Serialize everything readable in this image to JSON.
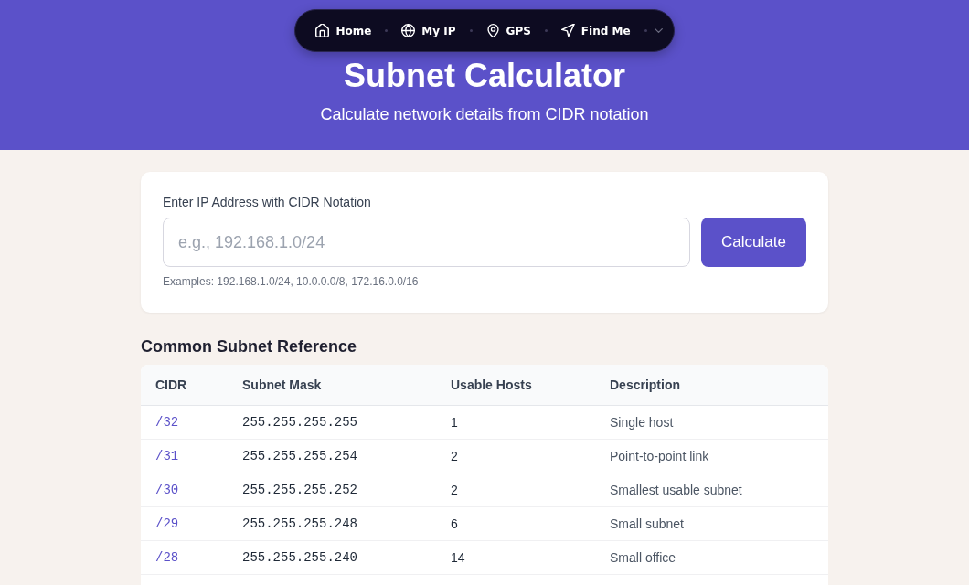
{
  "nav": {
    "items": [
      {
        "kind": "home",
        "label": "Home"
      },
      {
        "kind": "globe",
        "label": "My IP"
      },
      {
        "kind": "pin",
        "label": "GPS"
      },
      {
        "kind": "locate",
        "label": "Find Me"
      }
    ]
  },
  "header": {
    "title": "Subnet Calculator",
    "subtitle": "Calculate network details from CIDR notation"
  },
  "form": {
    "label": "Enter IP Address with CIDR Notation",
    "input": {
      "placeholder": "e.g., 192.168.1.0/24"
    },
    "button": "Calculate",
    "examples": "Examples: 192.168.1.0/24, 10.0.0.0/8, 172.16.0.0/16"
  },
  "reference": {
    "title": "Common Subnet Reference",
    "table": {
      "columns": [
        "CIDR",
        "Subnet Mask",
        "Usable Hosts",
        "Description"
      ],
      "rows": [
        [
          "/32",
          "255.255.255.255",
          "1",
          "Single host"
        ],
        [
          "/31",
          "255.255.255.254",
          "2",
          "Point-to-point link"
        ],
        [
          "/30",
          "255.255.255.252",
          "2",
          "Smallest usable subnet"
        ],
        [
          "/29",
          "255.255.255.248",
          "6",
          "Small subnet"
        ],
        [
          "/28",
          "255.255.255.240",
          "14",
          "Small office"
        ]
      ]
    }
  }
}
